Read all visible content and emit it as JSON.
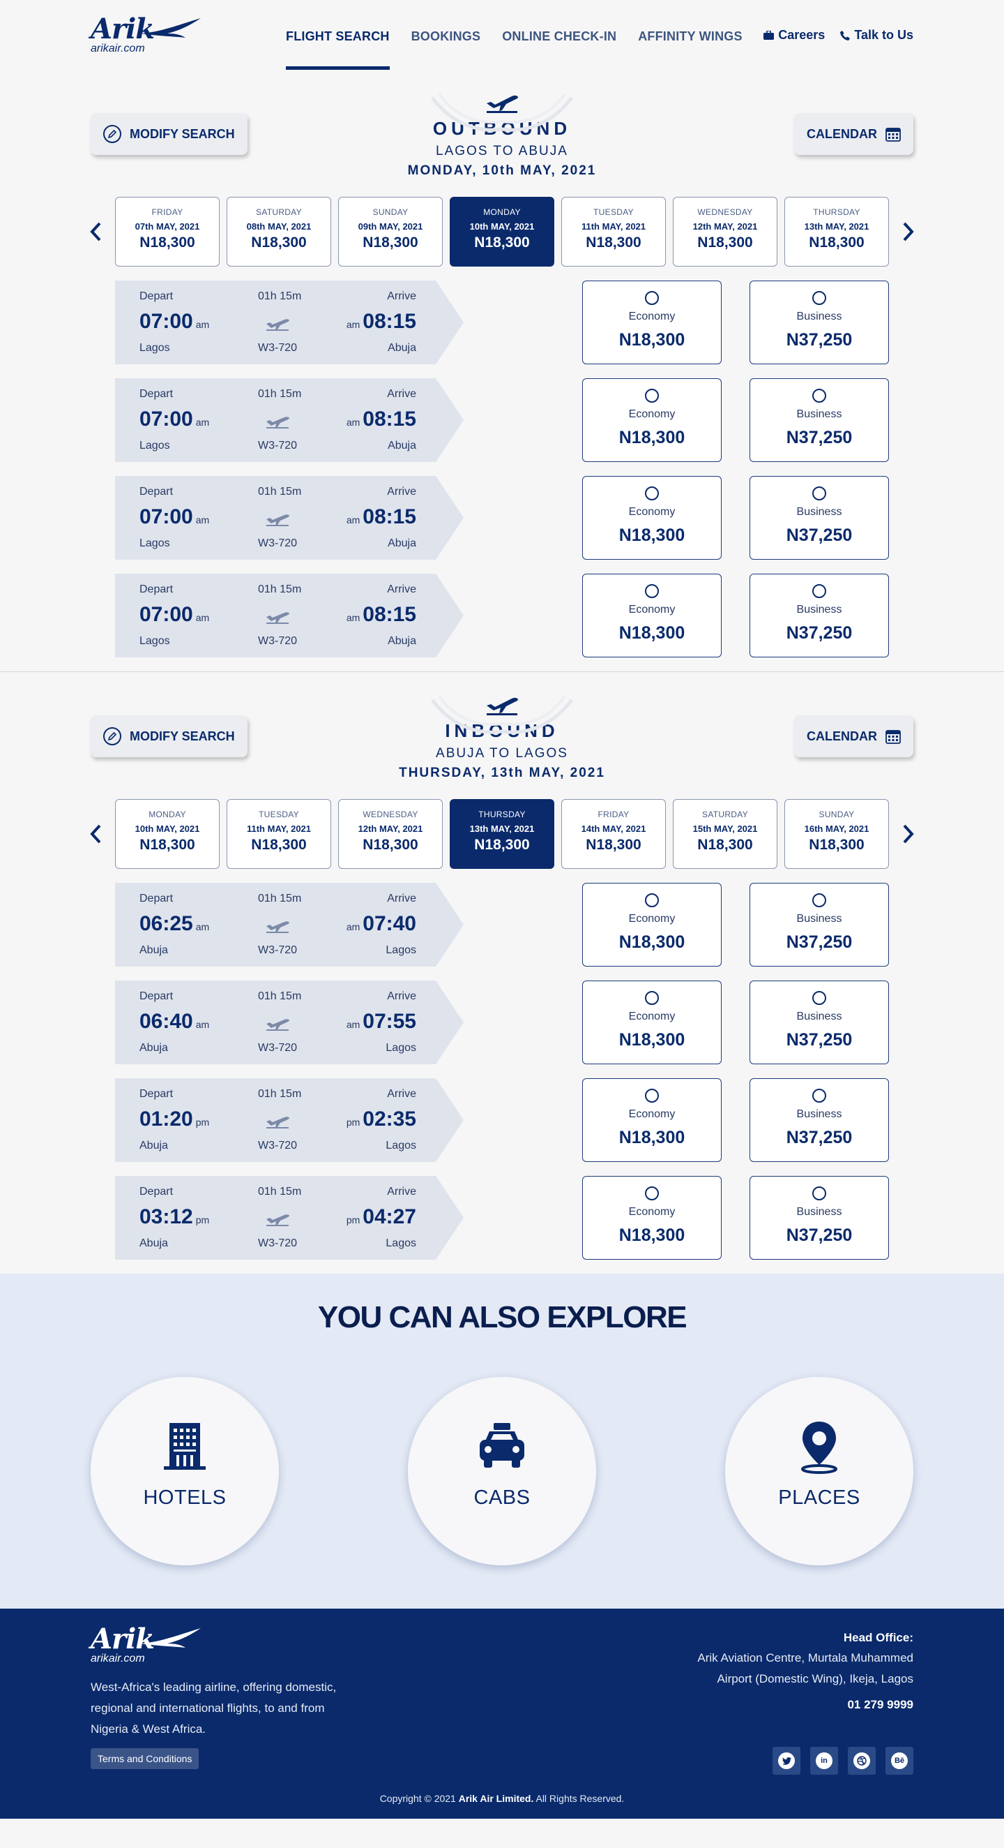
{
  "brand": {
    "name": "Arik",
    "domain": "arikair.com",
    "color": "#0a2a6b"
  },
  "nav": {
    "items": [
      {
        "label": "FLIGHT SEARCH",
        "active": true
      },
      {
        "label": "BOOKINGS",
        "active": false
      },
      {
        "label": "ONLINE CHECK-IN",
        "active": false
      },
      {
        "label": "AFFINITY WINGS",
        "active": false
      }
    ],
    "careers": "Careers",
    "talk": "Talk to Us"
  },
  "outbound": {
    "modify": "MODIFY SEARCH",
    "calendar": "CALENDAR",
    "title": "OUTBOUND",
    "route": "LAGOS TO ABUJA",
    "date_line": "MONDAY, 10th MAY, 2021",
    "dates": [
      {
        "day": "FRIDAY",
        "date": "07th MAY, 2021",
        "price": "N18,300"
      },
      {
        "day": "SATURDAY",
        "date": "08th MAY, 2021",
        "price": "N18,300"
      },
      {
        "day": "SUNDAY",
        "date": "09th MAY, 2021",
        "price": "N18,300"
      },
      {
        "day": "MONDAY",
        "date": "10th MAY, 2021",
        "price": "N18,300",
        "active": true
      },
      {
        "day": "TUESDAY",
        "date": "11th MAY, 2021",
        "price": "N18,300"
      },
      {
        "day": "WEDNESDAY",
        "date": "12th MAY, 2021",
        "price": "N18,300"
      },
      {
        "day": "THURSDAY",
        "date": "13th MAY, 2021",
        "price": "N18,300"
      }
    ],
    "flights": [
      {
        "depart_label": "Depart",
        "arrive_label": "Arrive",
        "duration": "01h 15m",
        "dep_time": "07:00",
        "dep_ampm": "am",
        "arr_time": "08:15",
        "arr_ampm": "am",
        "from": "Lagos",
        "to": "Abuja",
        "code": "W3-720",
        "economy_label": "Economy",
        "economy_price": "N18,300",
        "business_label": "Business",
        "business_price": "N37,250"
      },
      {
        "depart_label": "Depart",
        "arrive_label": "Arrive",
        "duration": "01h 15m",
        "dep_time": "07:00",
        "dep_ampm": "am",
        "arr_time": "08:15",
        "arr_ampm": "am",
        "from": "Lagos",
        "to": "Abuja",
        "code": "W3-720",
        "economy_label": "Economy",
        "economy_price": "N18,300",
        "business_label": "Business",
        "business_price": "N37,250"
      },
      {
        "depart_label": "Depart",
        "arrive_label": "Arrive",
        "duration": "01h 15m",
        "dep_time": "07:00",
        "dep_ampm": "am",
        "arr_time": "08:15",
        "arr_ampm": "am",
        "from": "Lagos",
        "to": "Abuja",
        "code": "W3-720",
        "economy_label": "Economy",
        "economy_price": "N18,300",
        "business_label": "Business",
        "business_price": "N37,250"
      },
      {
        "depart_label": "Depart",
        "arrive_label": "Arrive",
        "duration": "01h 15m",
        "dep_time": "07:00",
        "dep_ampm": "am",
        "arr_time": "08:15",
        "arr_ampm": "am",
        "from": "Lagos",
        "to": "Abuja",
        "code": "W3-720",
        "economy_label": "Economy",
        "economy_price": "N18,300",
        "business_label": "Business",
        "business_price": "N37,250"
      }
    ]
  },
  "inbound": {
    "modify": "MODIFY SEARCH",
    "calendar": "CALENDAR",
    "title": "INBOUND",
    "route": "ABUJA TO LAGOS",
    "date_line": "THURSDAY, 13th MAY, 2021",
    "dates": [
      {
        "day": "MONDAY",
        "date": "10th MAY, 2021",
        "price": "N18,300"
      },
      {
        "day": "TUESDAY",
        "date": "11th MAY, 2021",
        "price": "N18,300"
      },
      {
        "day": "WEDNESDAY",
        "date": "12th MAY, 2021",
        "price": "N18,300"
      },
      {
        "day": "THURSDAY",
        "date": "13th MAY, 2021",
        "price": "N18,300",
        "active": true
      },
      {
        "day": "FRIDAY",
        "date": "14th MAY, 2021",
        "price": "N18,300"
      },
      {
        "day": "SATURDAY",
        "date": "15th MAY, 2021",
        "price": "N18,300"
      },
      {
        "day": "SUNDAY",
        "date": "16th MAY, 2021",
        "price": "N18,300"
      }
    ],
    "flights": [
      {
        "depart_label": "Depart",
        "arrive_label": "Arrive",
        "duration": "01h 15m",
        "dep_time": "06:25",
        "dep_ampm": "am",
        "arr_time": "07:40",
        "arr_ampm": "am",
        "from": "Abuja",
        "to": "Lagos",
        "code": "W3-720",
        "economy_label": "Economy",
        "economy_price": "N18,300",
        "business_label": "Business",
        "business_price": "N37,250"
      },
      {
        "depart_label": "Depart",
        "arrive_label": "Arrive",
        "duration": "01h 15m",
        "dep_time": "06:40",
        "dep_ampm": "am",
        "arr_time": "07:55",
        "arr_ampm": "am",
        "from": "Abuja",
        "to": "Lagos",
        "code": "W3-720",
        "economy_label": "Economy",
        "economy_price": "N18,300",
        "business_label": "Business",
        "business_price": "N37,250"
      },
      {
        "depart_label": "Depart",
        "arrive_label": "Arrive",
        "duration": "01h 15m",
        "dep_time": "01:20",
        "dep_ampm": "pm",
        "arr_time": "02:35",
        "arr_ampm": "pm",
        "from": "Abuja",
        "to": "Lagos",
        "code": "W3-720",
        "economy_label": "Economy",
        "economy_price": "N18,300",
        "business_label": "Business",
        "business_price": "N37,250"
      },
      {
        "depart_label": "Depart",
        "arrive_label": "Arrive",
        "duration": "01h 15m",
        "dep_time": "03:12",
        "dep_ampm": "pm",
        "arr_time": "04:27",
        "arr_ampm": "pm",
        "from": "Abuja",
        "to": "Lagos",
        "code": "W3-720",
        "economy_label": "Economy",
        "economy_price": "N18,300",
        "business_label": "Business",
        "business_price": "N37,250"
      }
    ]
  },
  "explore": {
    "title": "YOU CAN ALSO EXPLORE",
    "items": [
      {
        "label": "HOTELS",
        "icon": "hotel-icon"
      },
      {
        "label": "CABS",
        "icon": "taxi-icon"
      },
      {
        "label": "PLACES",
        "icon": "map-pin-icon"
      }
    ]
  },
  "footer": {
    "description": "West-Africa's leading airline, offering domestic, regional and international flights, to and from Nigeria & West Africa.",
    "terms": "Terms and Conditions",
    "head_office_label": "Head Office:",
    "address_line1": "Arik Aviation Centre, Murtala Muhammed",
    "address_line2": "Airport (Domestic Wing), Ikeja, Lagos",
    "phone": "01 279 9999",
    "socials": [
      "twitter-icon",
      "linkedin-icon",
      "dribbble-icon",
      "behance-icon"
    ],
    "copyright_prefix": "Copyright © 2021",
    "copyright_company": "Arik Air Limited.",
    "copyright_suffix": "All Rights Reserved."
  }
}
